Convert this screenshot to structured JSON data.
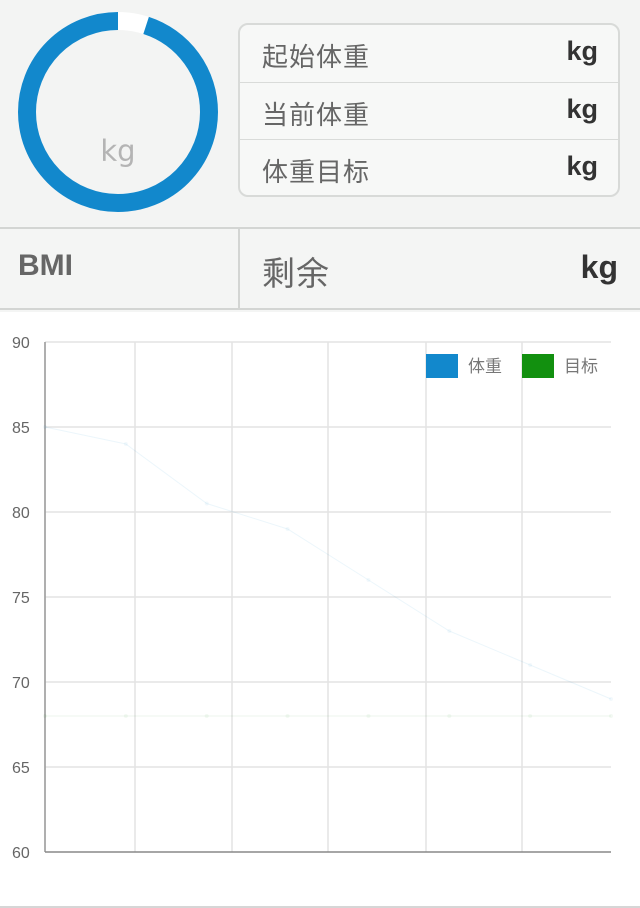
{
  "summary": {
    "ring_unit": "kg",
    "ring_progress": 0.95,
    "ring_color": "#1288cc",
    "rows": [
      {
        "label": "起始体重",
        "unit": "kg"
      },
      {
        "label": "当前体重",
        "unit": "kg"
      },
      {
        "label": "体重目标",
        "unit": "kg"
      }
    ]
  },
  "metrics": {
    "bmi_label": "BMI",
    "remaining_label": "剩余",
    "remaining_unit": "kg"
  },
  "chart_data": {
    "type": "line",
    "ylim": [
      60,
      90
    ],
    "yticks": [
      90,
      85,
      80,
      75,
      70,
      65,
      60
    ],
    "grid": true,
    "legend_position": "top-right",
    "series": [
      {
        "name": "体重",
        "color": "#1288cc",
        "values": [
          85,
          84,
          80.5,
          79,
          76,
          73,
          71,
          69
        ]
      },
      {
        "name": "目标",
        "color": "#12900f",
        "values": [
          68,
          68,
          68,
          68,
          68,
          68,
          68,
          68
        ]
      }
    ]
  }
}
